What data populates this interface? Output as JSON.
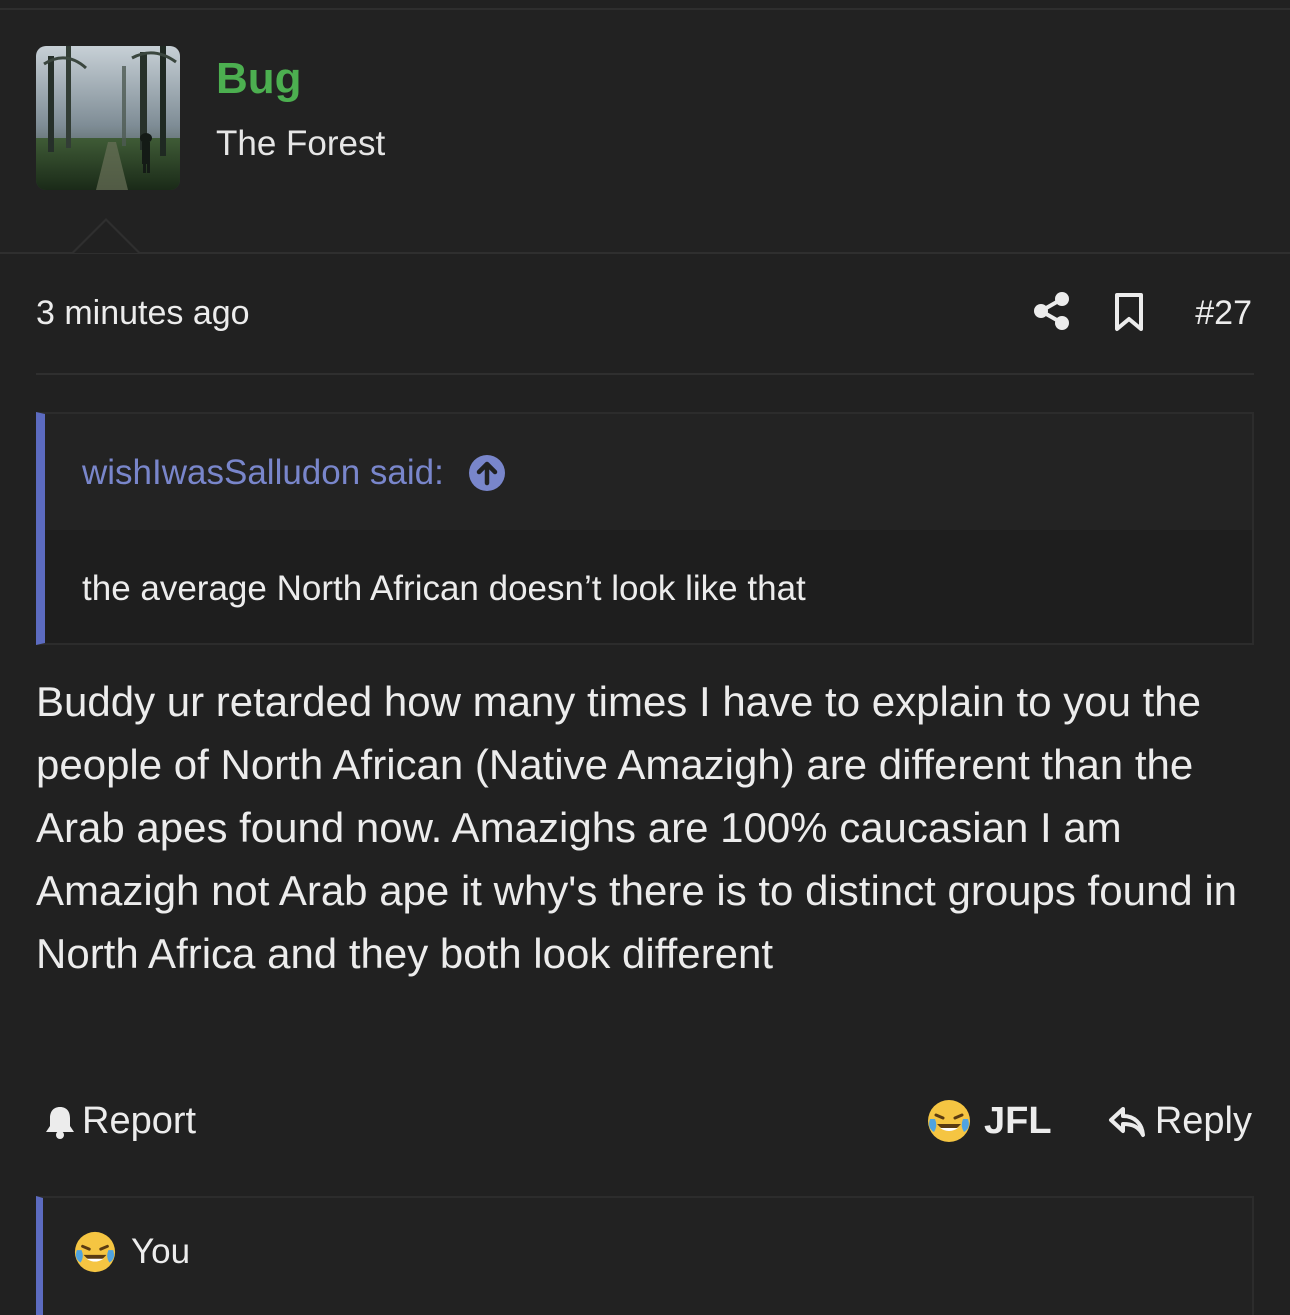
{
  "post": {
    "author": {
      "name": "Bug",
      "title": "The Forest",
      "name_color": "#4caf50"
    },
    "meta": {
      "timestamp": "3 minutes ago",
      "share_icon": "share-icon",
      "bookmark_icon": "bookmark-icon",
      "post_number": "#27"
    },
    "quote": {
      "author_line": "wishIwasSalludon said:",
      "jump_icon": "arrow-up-circle-icon",
      "text": "the average North African doesn’t look like that",
      "accent_color": "#5c6bc0"
    },
    "body": "Buddy ur retarded how many times I have to explain to you the people of North African (Native Amazigh) are different than the Arab apes found now. Amazighs are 100% caucasian I am Amazigh not Arab ape it why's there is to distinct groups found in North Africa and they both look different",
    "actions": {
      "report_label": "Report",
      "react_label": "JFL",
      "reply_label": "Reply"
    },
    "reactions": {
      "summary": "You",
      "emoji_icon": "crying-laughing-emoji-icon"
    }
  }
}
